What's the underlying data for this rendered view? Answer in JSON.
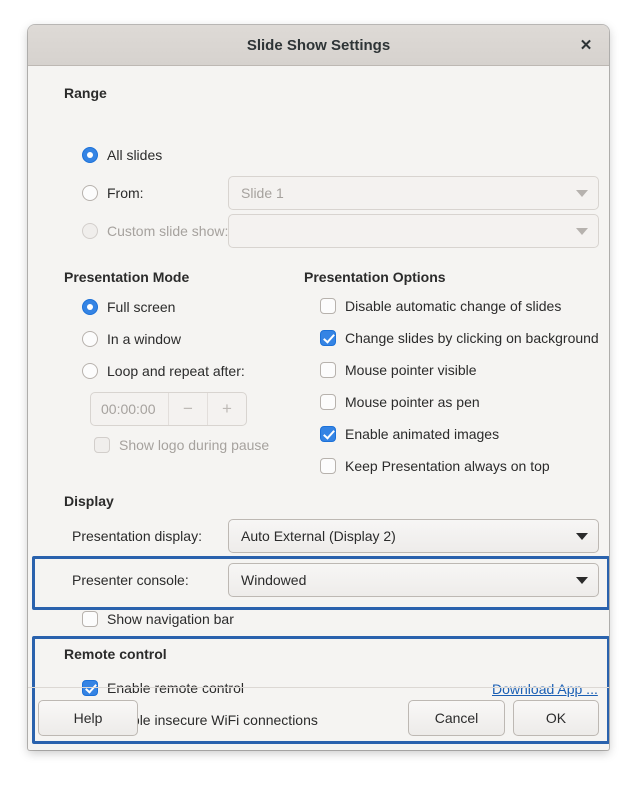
{
  "window": {
    "title": "Slide Show Settings",
    "close_icon": "close-icon"
  },
  "range": {
    "heading": "Range",
    "options": [
      {
        "label": "All slides",
        "selected": true,
        "disabled": false
      },
      {
        "label": "From:",
        "selected": false,
        "disabled": false
      },
      {
        "label": "Custom slide show:",
        "selected": false,
        "disabled": true
      }
    ],
    "from_dropdown": {
      "value": "Slide 1",
      "disabled": true
    },
    "custom_dropdown": {
      "value": "",
      "disabled": true
    }
  },
  "presentation_mode": {
    "heading": "Presentation Mode",
    "options": [
      {
        "label": "Full screen",
        "selected": true
      },
      {
        "label": "In a window",
        "selected": false
      },
      {
        "label": "Loop and repeat after:",
        "selected": false
      }
    ],
    "duration": {
      "value": "00:00:00",
      "minus_label": "−",
      "plus_label": "+"
    },
    "show_logo": {
      "label": "Show logo during pause",
      "checked": false,
      "disabled": true
    }
  },
  "presentation_options": {
    "heading": "Presentation Options",
    "items": [
      {
        "label": "Disable automatic change of slides",
        "checked": false
      },
      {
        "label": "Change slides by clicking on background",
        "checked": true
      },
      {
        "label": "Mouse pointer visible",
        "checked": false
      },
      {
        "label": "Mouse pointer as pen",
        "checked": false
      },
      {
        "label": "Enable animated images",
        "checked": true
      },
      {
        "label": "Keep Presentation always on top",
        "checked": false
      }
    ]
  },
  "display": {
    "heading": "Display",
    "presentation_display": {
      "label": "Presentation display:",
      "value": "Auto External (Display 2)"
    },
    "presenter_console": {
      "label": "Presenter console:",
      "value": "Windowed"
    },
    "show_navigation_bar": {
      "label": "Show navigation bar",
      "checked": false
    }
  },
  "remote_control": {
    "heading": "Remote control",
    "enable_remote": {
      "label": "Enable remote control",
      "checked": true
    },
    "enable_wifi": {
      "label": "Enable insecure WiFi connections",
      "checked": false
    },
    "download_link": "Download App ..."
  },
  "footer": {
    "help": "Help",
    "cancel": "Cancel",
    "ok": "OK"
  },
  "colors": {
    "accent": "#3584e4",
    "link": "#1a5fb4",
    "highlight": "#2a62ad",
    "titlebar": "#d8d4d0",
    "body": "#f5f4f2"
  }
}
